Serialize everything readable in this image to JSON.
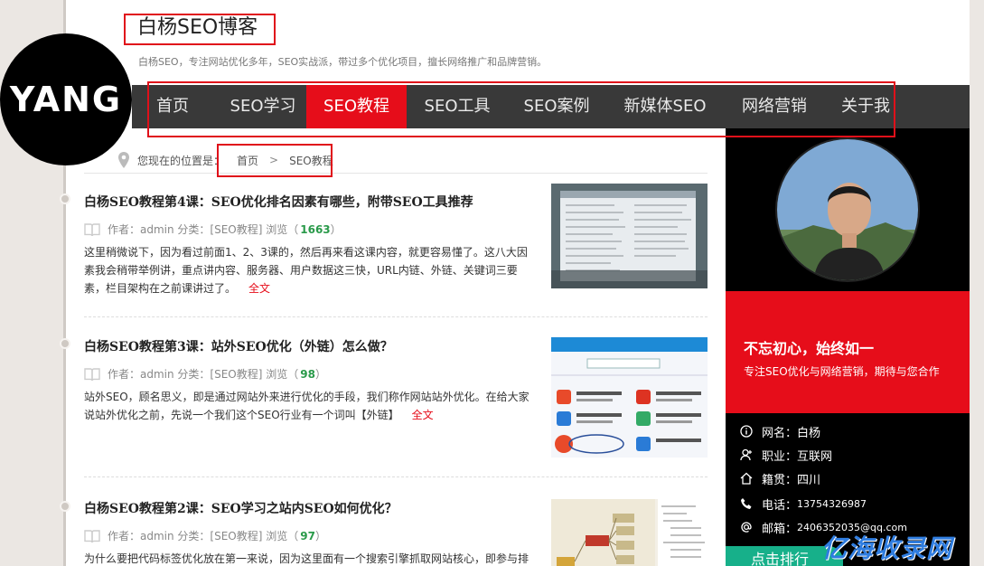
{
  "header": {
    "logo_text": "YANG",
    "site_title": "白杨SEO博客",
    "site_desc": "白杨SEO，专注网站优化多年，SEO实战派，带过多个优化项目，擅长网络推广和品牌营销。"
  },
  "nav": {
    "items": [
      "首页",
      "SEO学习",
      "SEO教程",
      "SEO工具",
      "SEO案例",
      "新媒体SEO",
      "网络营销",
      "关于我"
    ],
    "active": "SEO教程"
  },
  "breadcrumb": {
    "prefix": "您现在的位置是：",
    "home": "首页",
    "separator": ">",
    "current": "SEO教程"
  },
  "articles": [
    {
      "title": "白杨SEO教程第4课：SEO优化排名因素有哪些，附带SEO工具推荐",
      "meta_prefix": "作者：admin 分类：[SEO教程] 浏览（",
      "views": "1663",
      "meta_suffix": "）",
      "excerpt": "这里稍微说下，因为看过前面1、2、3课的，然后再来看这课内容，就更容易懂了。这八大因素我会稍带举例讲，重点讲内容、服务器、用户数据这三快，URL内链、外链、关键词三要素，栏目架构在之前课讲过了。",
      "read_more": "全文"
    },
    {
      "title": "白杨SEO教程第3课：站外SEO优化（外链）怎么做？",
      "meta_prefix": "作者：admin 分类：[SEO教程] 浏览（",
      "views": "98",
      "meta_suffix": "）",
      "excerpt": "站外SEO，顾名思义，即是通过网站外来进行优化的手段，我们称作网站站外优化。在给大家说站外优化之前，先说一个我们这个SEO行业有一个词叫【外链】",
      "read_more": "全文"
    },
    {
      "title": "白杨SEO教程第2课：SEO学习之站内SEO如何优化？",
      "meta_prefix": "作者：admin 分类：[SEO教程] 浏览（",
      "views": "97",
      "meta_suffix": "）",
      "excerpt": "为什么要把代码标签优化放在第一来说，因为这里面有一个搜索引擎抓取网站核心，即参与排",
      "read_more": ""
    }
  ],
  "sidebar": {
    "motto": "不忘初心，始终如一",
    "motto_sub": "专注SEO优化与网络营销，期待与您合作",
    "info": [
      {
        "icon": "info-icon",
        "label": "网名：",
        "value": "白杨"
      },
      {
        "icon": "user-icon",
        "label": "职业：",
        "value": "互联网"
      },
      {
        "icon": "home-icon",
        "label": "籍贯：",
        "value": "四川"
      },
      {
        "icon": "phone-icon",
        "label": "电话：",
        "value": "13754326987"
      },
      {
        "icon": "at-icon",
        "label": "邮箱：",
        "value": "2406352035@qq.com"
      }
    ],
    "rank_tab": "点击排行"
  },
  "watermark": "亿海收录网",
  "colors": {
    "accent_red": "#e60d1a",
    "nav_bg": "#393939",
    "sidebar_bg": "#000000",
    "views_green": "#2a9a4a",
    "rank_tab_green": "#17b08a",
    "highlight_border": "#e0101a"
  }
}
